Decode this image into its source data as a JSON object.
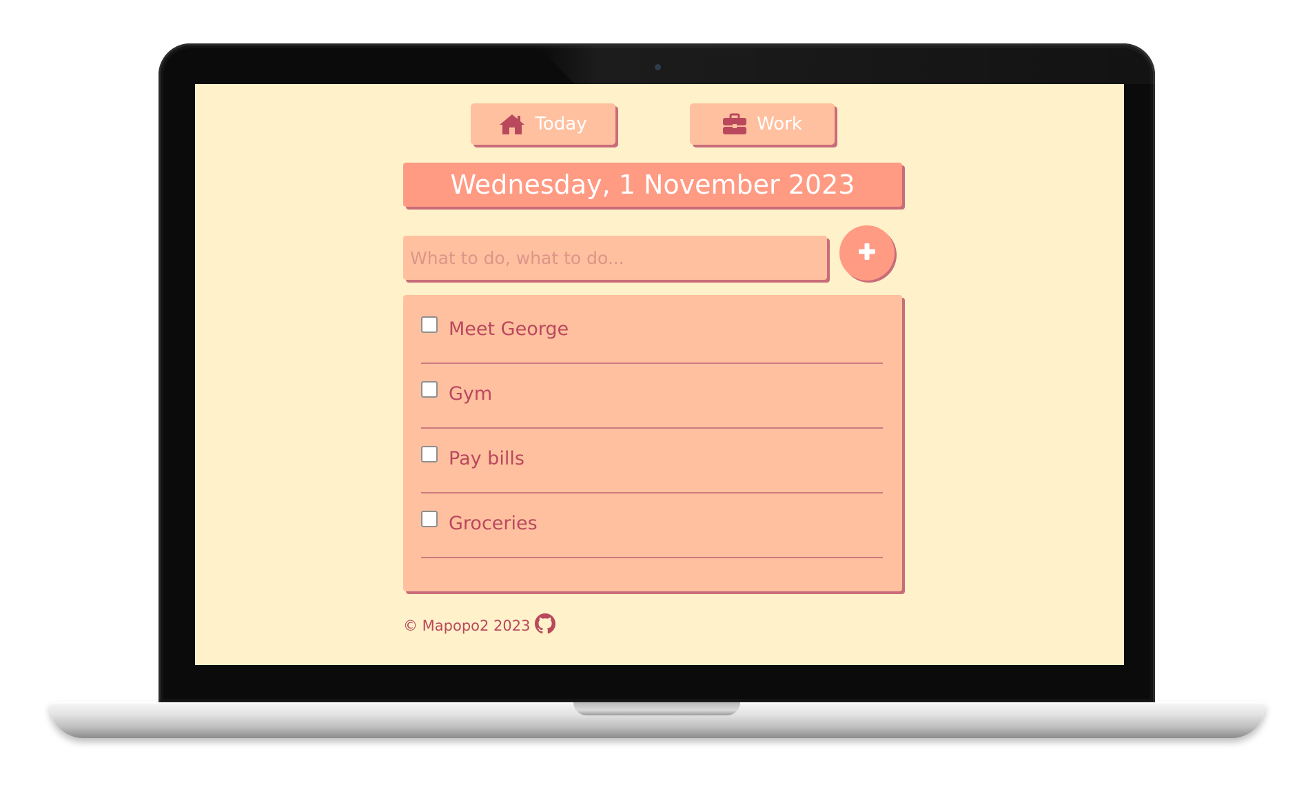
{
  "nav": {
    "today_label": "Today",
    "today_icon": "home-icon",
    "work_label": "Work",
    "work_icon": "briefcase-icon"
  },
  "date_banner": "Wednesday, 1 November 2023",
  "new_task": {
    "value": "",
    "placeholder": "What to do, what to do...",
    "add_icon": "plus-icon"
  },
  "tasks": [
    {
      "label": "Meet George",
      "checked": false
    },
    {
      "label": "Gym",
      "checked": false
    },
    {
      "label": "Pay bills",
      "checked": false
    },
    {
      "label": "Groceries",
      "checked": false
    }
  ],
  "footer": {
    "text": "© Mapopo2 2023",
    "icon": "github-icon"
  },
  "colors": {
    "background": "#fff1c9",
    "peach": "#ffc09f",
    "salmon": "#ff9a83",
    "accent_text": "#b9485d",
    "shadow": "#c96c7a"
  }
}
